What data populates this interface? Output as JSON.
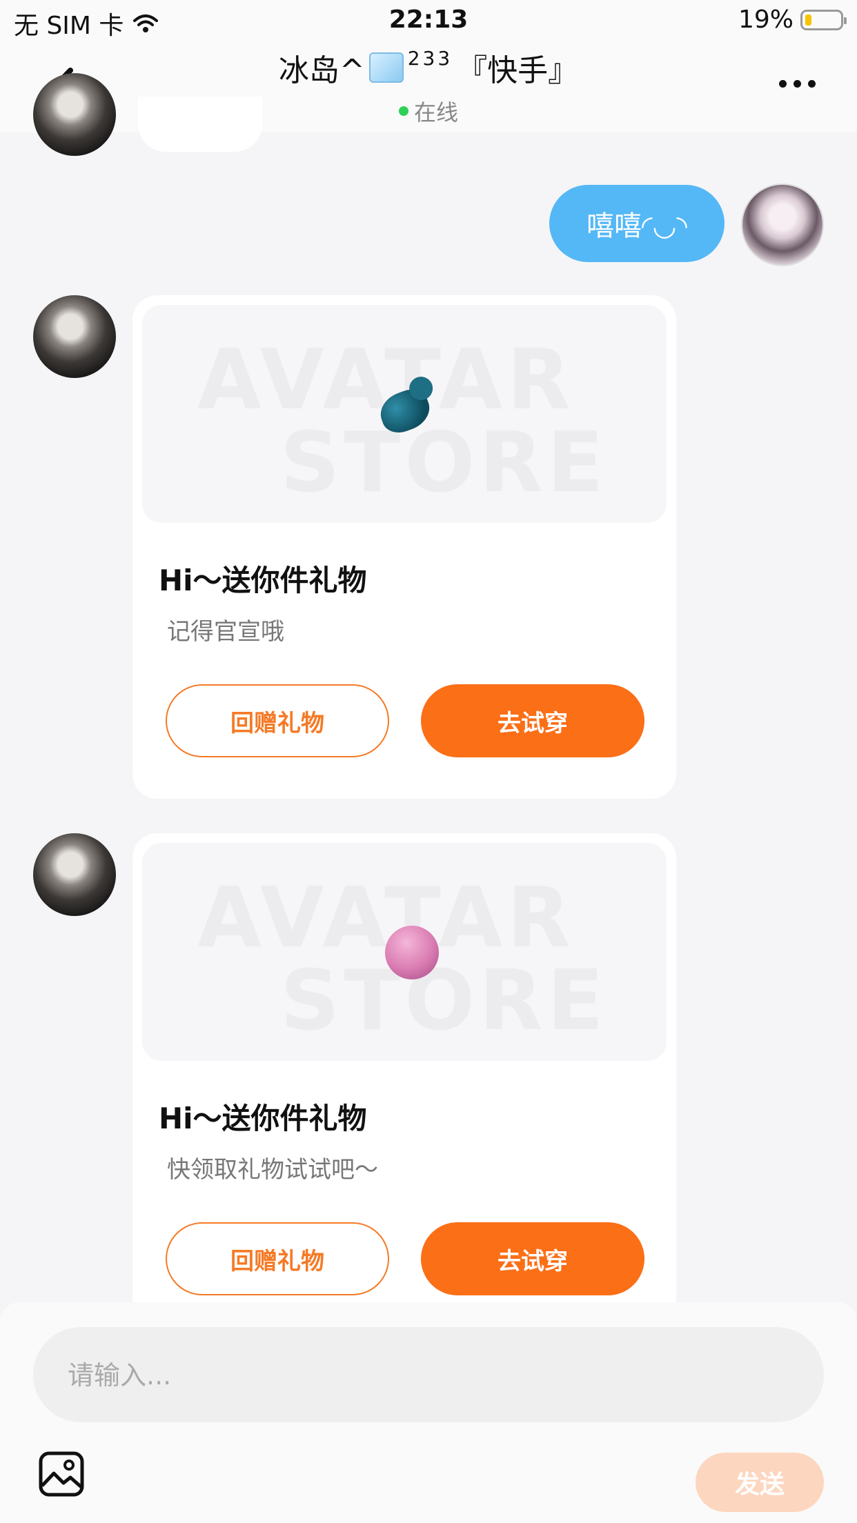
{
  "status_bar": {
    "carrier": "无 SIM 卡",
    "time": "22:13",
    "battery_percent": "19%",
    "battery_level": 0.19
  },
  "nav": {
    "title_name": "冰岛^",
    "title_sup": "233",
    "title_suffix": "『快手』",
    "status": "在线"
  },
  "messages": {
    "me_text": "嘻嘻◜◡◝",
    "cards": [
      {
        "title": "Hi～送你件礼物",
        "subtitle": "记得官宣哦",
        "btn_return": "回赠礼物",
        "btn_try": "去试穿",
        "gift_icon": "pacifier-icon"
      },
      {
        "title": "Hi～送你件礼物",
        "subtitle": "快领取礼物试试吧～",
        "btn_return": "回赠礼物",
        "btn_try": "去试穿",
        "gift_icon": "ball-icon"
      }
    ],
    "watermark_line1": "AVATAR",
    "watermark_line2": "STORE"
  },
  "composer": {
    "placeholder": "请输入...",
    "send_label": "发送"
  },
  "colors": {
    "accent_orange": "#fb6f17",
    "bubble_blue": "#55b8f6",
    "online_green": "#2ed158"
  }
}
